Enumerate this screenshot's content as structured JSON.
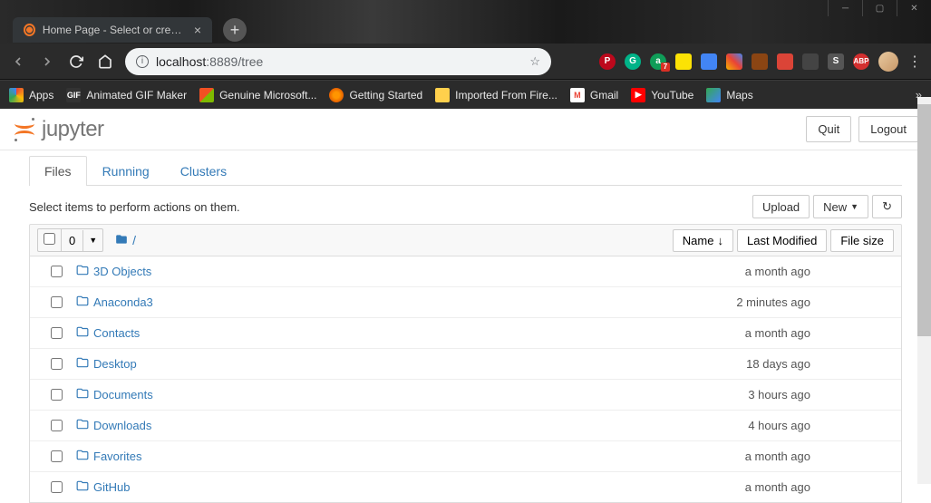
{
  "window": {
    "tab_title": "Home Page - Select or create a n"
  },
  "nav": {
    "url_host": "localhost",
    "url_port": ":8889",
    "url_path": "/tree"
  },
  "extensions": {
    "badge_count": "7"
  },
  "bookmarks": [
    {
      "label": "Apps"
    },
    {
      "label": "Animated GIF Maker"
    },
    {
      "label": "Genuine Microsoft..."
    },
    {
      "label": "Getting Started"
    },
    {
      "label": "Imported From Fire..."
    },
    {
      "label": "Gmail"
    },
    {
      "label": "YouTube"
    },
    {
      "label": "Maps"
    }
  ],
  "jupyter": {
    "logo_text": "jupyter",
    "quit": "Quit",
    "logout": "Logout",
    "tabs": {
      "files": "Files",
      "running": "Running",
      "clusters": "Clusters"
    },
    "hint": "Select items to perform actions on them.",
    "upload": "Upload",
    "new": "New",
    "select_count": "0",
    "breadcrumb_root": "/",
    "col_name": "Name",
    "col_modified": "Last Modified",
    "col_size": "File size",
    "rows": [
      {
        "name": "3D Objects",
        "modified": "a month ago"
      },
      {
        "name": "Anaconda3",
        "modified": "2 minutes ago"
      },
      {
        "name": "Contacts",
        "modified": "a month ago"
      },
      {
        "name": "Desktop",
        "modified": "18 days ago"
      },
      {
        "name": "Documents",
        "modified": "3 hours ago"
      },
      {
        "name": "Downloads",
        "modified": "4 hours ago"
      },
      {
        "name": "Favorites",
        "modified": "a month ago"
      },
      {
        "name": "GitHub",
        "modified": "a month ago"
      }
    ]
  }
}
